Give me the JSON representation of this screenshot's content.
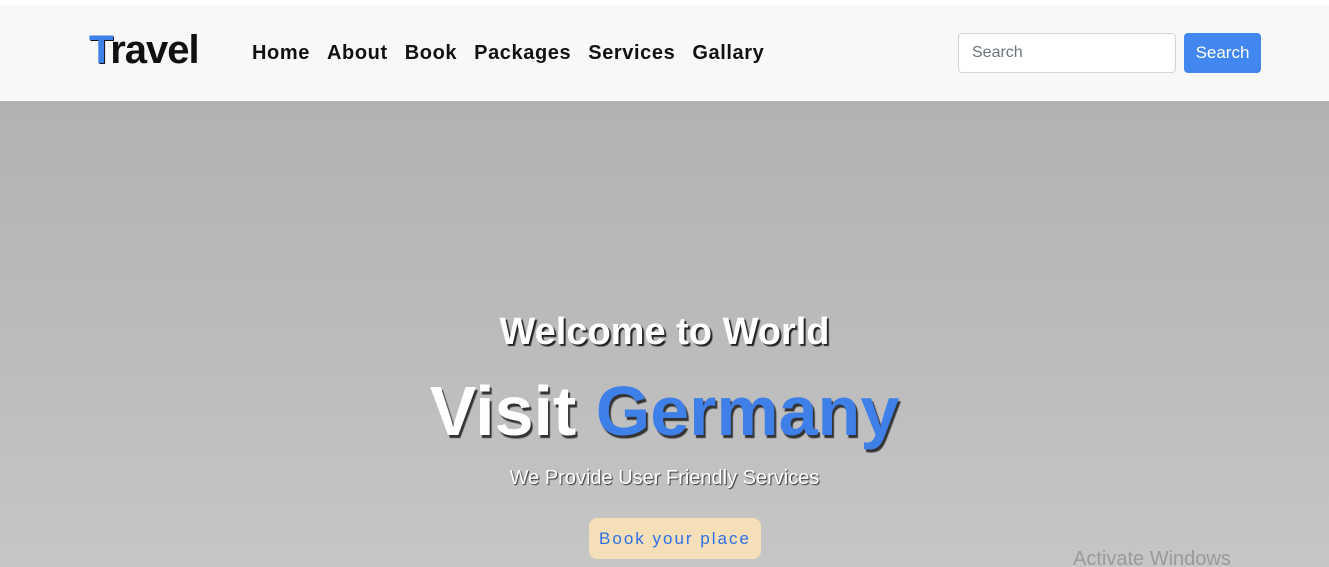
{
  "navbar": {
    "brand_first": "T",
    "brand_rest": "ravel",
    "links": [
      "Home",
      "About",
      "Book",
      "Packages",
      "Services",
      "Gallary"
    ],
    "search_placeholder": "Search",
    "search_button": "Search"
  },
  "hero": {
    "welcome": "Welcome to World",
    "title_plain": "Visit",
    "title_accent": "Germany",
    "subtitle": "We Provide User Friendly Services",
    "cta": "Book your place"
  },
  "os_overlay": {
    "watermark": "Activate Windows"
  },
  "colors": {
    "accent": "#3f7fe8",
    "search_button": "#4286f0",
    "cta_background": "#f5dfb8",
    "navbar_background": "#f8f8f8"
  }
}
